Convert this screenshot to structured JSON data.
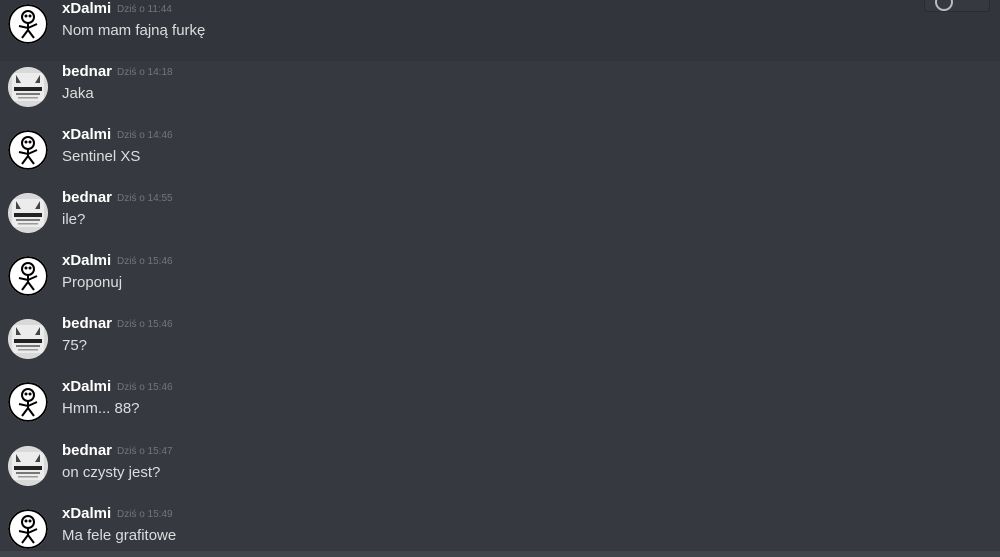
{
  "channel": {
    "messages": [
      {
        "author": "xDalmi",
        "time": "Dziś o 11:44",
        "text": "Nom mam fajną furkę"
      },
      {
        "author": "bednar",
        "time": "Dziś o 14:18",
        "text": "Jaka"
      },
      {
        "author": "xDalmi",
        "time": "Dziś o 14:46",
        "text": "Sentinel XS"
      },
      {
        "author": "bednar",
        "time": "Dziś o 14:55",
        "text": "ile?"
      },
      {
        "author": "xDalmi",
        "time": "Dziś o 15:46",
        "text": "Proponuj"
      },
      {
        "author": "bednar",
        "time": "Dziś o 15:46",
        "text": "75?"
      },
      {
        "author": "xDalmi",
        "time": "Dziś o 15:46",
        "text": "Hmm... 88?"
      },
      {
        "author": "bednar",
        "time": "Dziś o 15:47",
        "text": "on czysty jest?"
      },
      {
        "author": "xDalmi",
        "time": "Dziś o 15:49",
        "text": "Ma fele grafitowe"
      }
    ]
  },
  "avatars": {
    "xDalmi": "stick-figure-icon",
    "bednar": "poster-icon"
  },
  "colors": {
    "background": "#36393f",
    "hover_background": "#32353b",
    "author": "#ffffff",
    "message_text": "#dcddde",
    "timestamp": "#72767d"
  }
}
